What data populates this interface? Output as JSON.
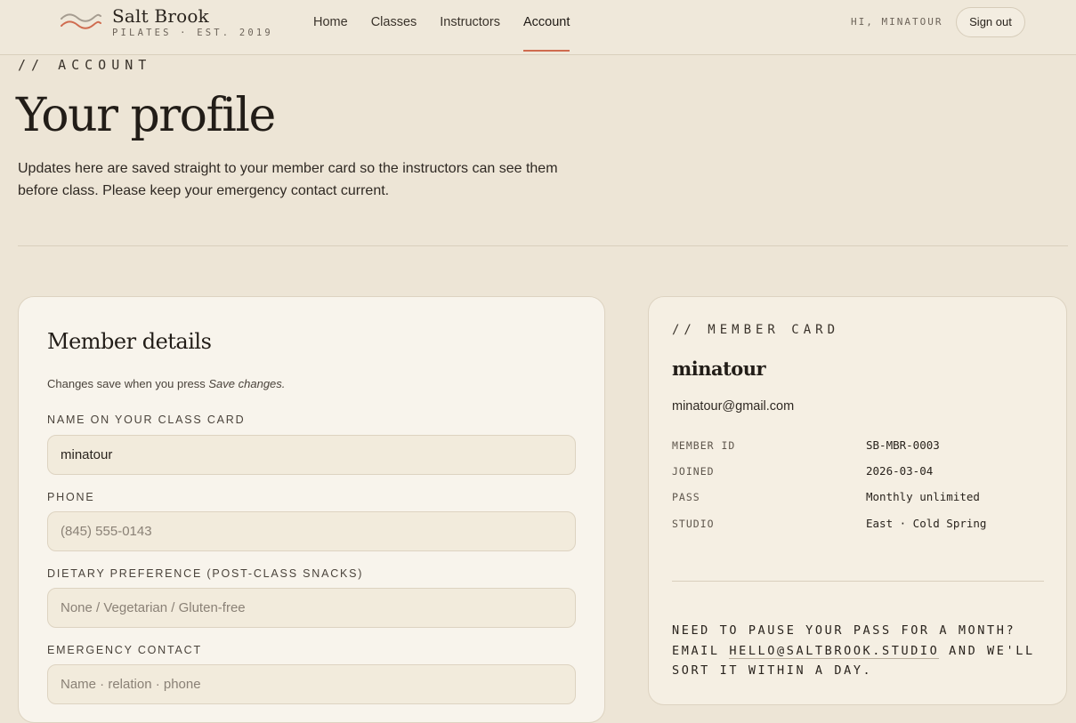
{
  "brand": {
    "name": "Salt Brook",
    "tagline": "PILATES · EST. 2019"
  },
  "nav": [
    {
      "label": "Home",
      "active": false
    },
    {
      "label": "Classes",
      "active": false
    },
    {
      "label": "Instructors",
      "active": false
    },
    {
      "label": "Account",
      "active": true
    }
  ],
  "header": {
    "greeting": "HI, MINATOUR",
    "signout_label": "Sign out"
  },
  "page": {
    "eyebrow": "// ACCOUNT",
    "title": "Your profile",
    "intro": "Updates here are saved straight to your member card so the instructors can see them before class. Please keep your emergency contact current."
  },
  "form": {
    "title": "Member details",
    "note_prefix": "Changes save when you press ",
    "note_action": "Save changes.",
    "fields": [
      {
        "label": "NAME ON YOUR CLASS CARD",
        "value": "minatour",
        "placeholder": ""
      },
      {
        "label": "PHONE",
        "value": "",
        "placeholder": "(845) 555-0143"
      },
      {
        "label": "DIETARY PREFERENCE (POST-CLASS SNACKS)",
        "value": "",
        "placeholder": "None / Vegetarian / Gluten-free"
      },
      {
        "label": "EMERGENCY CONTACT",
        "value": "",
        "placeholder": "Name · relation · phone"
      }
    ]
  },
  "member_card": {
    "eyebrow": "// MEMBER CARD",
    "name": "minatour",
    "email": "minatour@gmail.com",
    "details": [
      {
        "key": "MEMBER ID",
        "value": "SB-MBR-0003"
      },
      {
        "key": "JOINED",
        "value": "2026-03-04"
      },
      {
        "key": "PASS",
        "value": "Monthly unlimited"
      },
      {
        "key": "STUDIO",
        "value": "East · Cold Spring"
      }
    ],
    "footer_prefix": "NEED TO PAUSE YOUR PASS FOR A MONTH? EMAIL ",
    "footer_email": "HELLO@SALTBROOK.STUDIO",
    "footer_suffix": " AND WE'LL SORT IT WITHIN A DAY."
  },
  "colors": {
    "accent": "#cf6b4f",
    "background": "#ede5d6",
    "panel": "#f8f4ec",
    "wave_grey": "#a59c90"
  }
}
